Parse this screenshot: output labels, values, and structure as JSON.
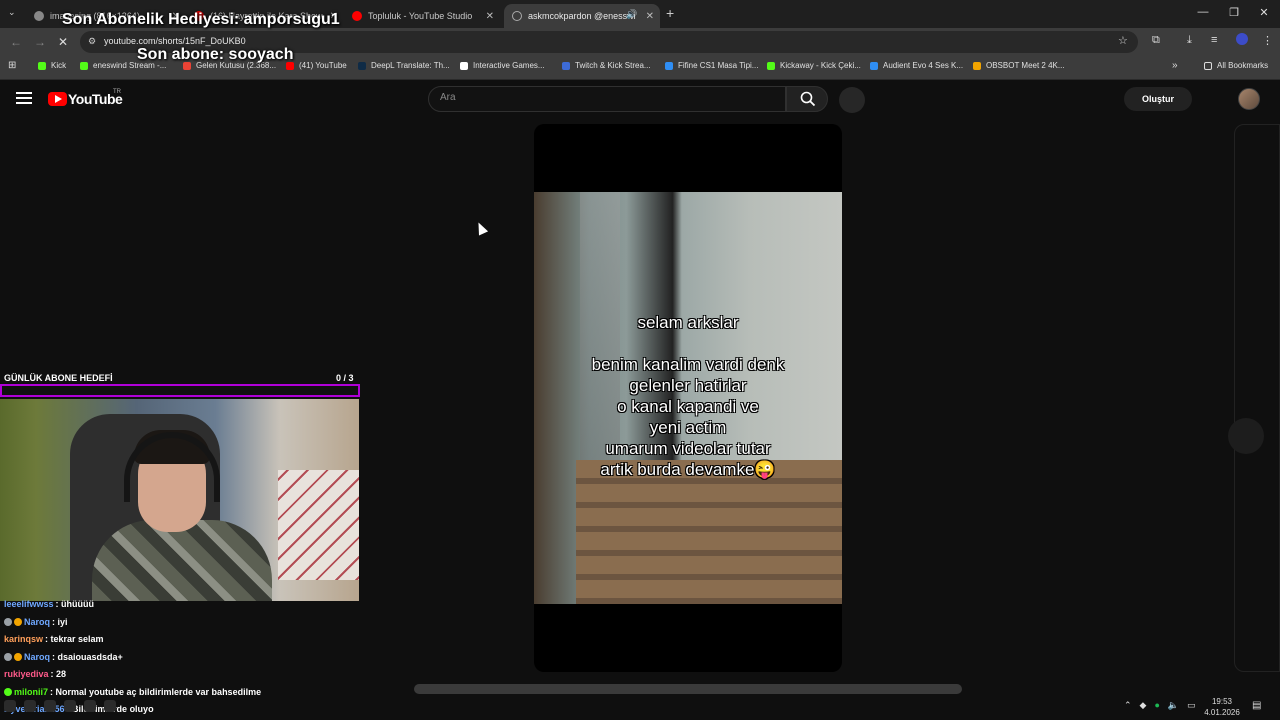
{
  "browser": {
    "tabs": [
      {
        "label": "imagesing (816×1264)",
        "active": false
      },
      {
        "label": "(16) Hayrettin ile Kara Show",
        "active": false
      },
      {
        "label": "Topluluk - YouTube Studio",
        "active": false
      },
      {
        "label": "askmcokpardon @enesswi",
        "active": true
      }
    ],
    "new_tab": "+",
    "url": "youtube.com/shorts/15nF_DoUKB0",
    "bookmarks": [
      {
        "label": "Kick",
        "color": "#53fc18"
      },
      {
        "label": "eneswind Stream -...",
        "color": "#53fc18"
      },
      {
        "label": "Gelen Kutusu (2.368...",
        "color": "#ea4335"
      },
      {
        "label": "(41) YouTube",
        "color": "#ff0000"
      },
      {
        "label": "DeepL Translate: Th...",
        "color": "#0f2b46"
      },
      {
        "label": "Interactive Games...",
        "color": "#ffffff"
      },
      {
        "label": "Twitch & Kick Strea...",
        "color": "#3d6bd6"
      },
      {
        "label": "Fifine CS1 Masa Tipi...",
        "color": "#2f8ef4"
      },
      {
        "label": "Kickaway - Kick Çeki...",
        "color": "#53fc18"
      },
      {
        "label": "Audient Evo 4 Ses K...",
        "color": "#2f8ef4"
      },
      {
        "label": "OBSBOT Meet 2 4K...",
        "color": "#f2a400"
      }
    ],
    "all_bookmarks": "All Bookmarks"
  },
  "overlay": {
    "last_gift": "Son Abonelik Hediyesi: amporsugu1",
    "last_sub": "Son abone: sooyach",
    "goal_label": "GÜNLÜK ABONE HEDEFİ",
    "goal_count": "0  / 3",
    "goal_progress": 0
  },
  "youtube": {
    "logo": "YouTube",
    "country": "TR",
    "search_placeholder": "Ara",
    "create_label": "Oluştur"
  },
  "short": {
    "caption_title": "selam arkslar",
    "caption_lines": [
      "benim kanalim vardi denk",
      "gelenler hatirlar",
      "o kanal kapandi ve",
      "yeni actim",
      "umarum videolar tutar",
      "artik burda devamke😜"
    ]
  },
  "chat": [
    {
      "user": "leeelifwwss",
      "color": "#6fa8ff",
      "badges": [],
      "msg": "ühüüüü"
    },
    {
      "user": "Naroq",
      "color": "#6fa8ff",
      "badges": [
        "#9aa0a6",
        "#f2a400"
      ],
      "msg": "iyi"
    },
    {
      "user": "karinqsw",
      "color": "#ff9f5a",
      "badges": [],
      "msg": "tekrar selam"
    },
    {
      "user": "Naroq",
      "color": "#6fa8ff",
      "badges": [
        "#9aa0a6",
        "#f2a400"
      ],
      "msg": "dsaiouasdsda+"
    },
    {
      "user": "rukiyediva",
      "color": "#ff5a8a",
      "badges": [],
      "msg": "28"
    },
    {
      "user": "milonii7",
      "color": "#53fc18",
      "badges": [
        "#53fc18"
      ],
      "msg": "Normal youtube aç bildirimlerde var bahsedilme"
    },
    {
      "user": "Byveloria1256",
      "color": "#6fa8ff",
      "badges": [],
      "msg": "Bildirimlerde oluyo"
    }
  ],
  "taskbar": {
    "time": "19:53",
    "date": "4.01.2026"
  }
}
